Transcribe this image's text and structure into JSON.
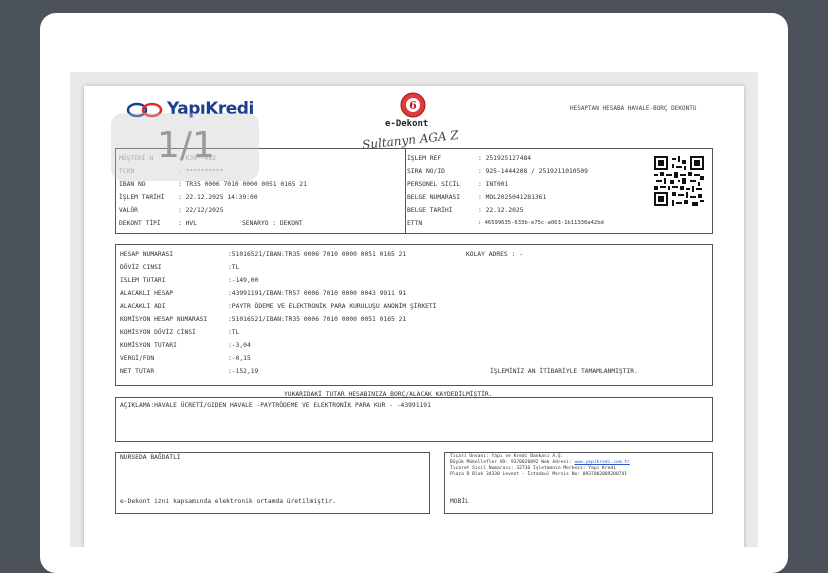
{
  "viewer": {
    "page_counter": "1/1"
  },
  "header": {
    "bank_logo_text": "YapıKredi",
    "doc_title": "e-Dekont",
    "top_right_title": "HESAPTAN HESABA HAVALE-BORÇ DEKONTU",
    "signature_text": "Sultanyn AGA Z"
  },
  "info_left": [
    {
      "label": "MÜŞTERİ N",
      "value": ": 639**482"
    },
    {
      "label": "TCKN",
      "value": ": **********"
    },
    {
      "label": "IBAN NO",
      "value": ": TR35 0006 7010 0000 0051 0165 21"
    },
    {
      "label": "İŞLEM TARİHİ",
      "value": ": 22.12.2025 14:39:00"
    },
    {
      "label": "VALÖR",
      "value": ": 22/12/2025"
    },
    {
      "label": "DEKONT TİPİ",
      "value": ": HVL"
    }
  ],
  "info_left_extra": {
    "senaryo": "SENARYO  : DEKONT"
  },
  "info_right": [
    {
      "label": "İŞLEM REF",
      "value": ": 251925127484"
    },
    {
      "label": "SIRA NO/ID",
      "value": ": 925-1444208 / 2519211010509"
    },
    {
      "label": "PERSONEL SİCİL",
      "value": ": INT001"
    },
    {
      "label": "BELGE NUMARASI",
      "value": ": MOL2025041281361"
    },
    {
      "label": "BELGE TARİHİ",
      "value": ": 22.12.2025"
    },
    {
      "label": "ETTN",
      "value": ": 46599635-633b-e75c-a063-1b11330a42bd"
    }
  ],
  "details": [
    {
      "label": "HESAP NUMARASI",
      "value": ":51016521/IBAN:TR35 0006 7010 0000 0051 0165 21"
    },
    {
      "label": "DÖVİZ CINSI",
      "value": ":TL"
    },
    {
      "label": "ISLEM TUTARI",
      "value": ":-149,00"
    },
    {
      "label": "ALACAKLI HESAP",
      "value": ":43991191/IBAN:TR57 0006 7010 0000 0043 9911 91"
    },
    {
      "label": "ALACAKLI ADI",
      "value": ":PAYTR ÖDEME VE ELEKTRONİK PARA KURULUŞU ANONİM ŞİRKETİ"
    },
    {
      "label": "KOMİSYON HESAP NUMARASI",
      "value": ":51016521/IBAN:TR35 0006 7010 0000 0051 0165 21"
    },
    {
      "label": "KOMİSYON DÖVİZ CİNSİ",
      "value": ":TL"
    },
    {
      "label": "KOMİSYON TUTARI",
      "value": ":-3,04"
    },
    {
      "label": "VERGİ/FON",
      "value": ":-0,15"
    },
    {
      "label": "NET TUTAR",
      "value": ":-152,19"
    }
  ],
  "kolay_adres": "KOLAY ADRES   : -",
  "islem_status": "İŞLEMİNİZ AN İTİBARİYLE TAMAMLANMIŞTIR.",
  "mid_notice": "YUKARIDAKİ TUTAR HESABINIZA BORÇ/ALACAK KAYDEDİLMİŞTİR.",
  "aciklama": "AÇIKLAMA:HAVALE ÜCRETİ/GIDEN HAVALE -PAYTRÖDEME VE ELEKTRONİK PARA KUR - -43991191",
  "footer_left": {
    "name": "NURSEDA BAĞDATLI",
    "note": "e-Dekont izni kapsamında elektronik ortamda üretilmiştir."
  },
  "footer_right": {
    "line1": "Ticari Unvanı: Yapı ve Kredi Bankası A.Ş.",
    "line2_pre": "Büyük Mükellefler VD: 9370020892 Web Adresi: ",
    "line2_link": "www.yapikredi.com.tr",
    "line3": "Ticaret Sicil Numarası: 32736 İşletmenin Merkezi: Yapı Kredi",
    "line4": "Plaza D Blok 34330 Levent - İstanbul Mersis No: 0937002089200741",
    "channel": "MOBİL"
  }
}
